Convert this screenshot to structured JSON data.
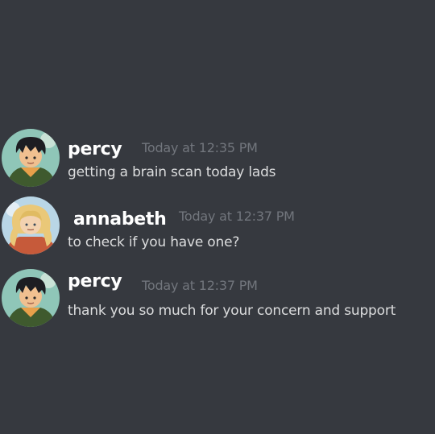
{
  "theme": {
    "background": "#36393f",
    "username_color": "#ffffff",
    "timestamp_color": "#72767d",
    "text_color": "#dcddde"
  },
  "messages": [
    {
      "author": "percy",
      "avatar_icon": "percy-avatar",
      "timestamp": "Today at 12:35 PM",
      "content": "getting a brain scan today lads"
    },
    {
      "author": "annabeth",
      "avatar_icon": "annabeth-avatar",
      "timestamp": "Today at 12:37 PM",
      "content": "to check if you have one?"
    },
    {
      "author": "percy",
      "avatar_icon": "percy-avatar",
      "timestamp": "Today at 12:37 PM",
      "content": "thank you so much for your concern and support"
    }
  ]
}
